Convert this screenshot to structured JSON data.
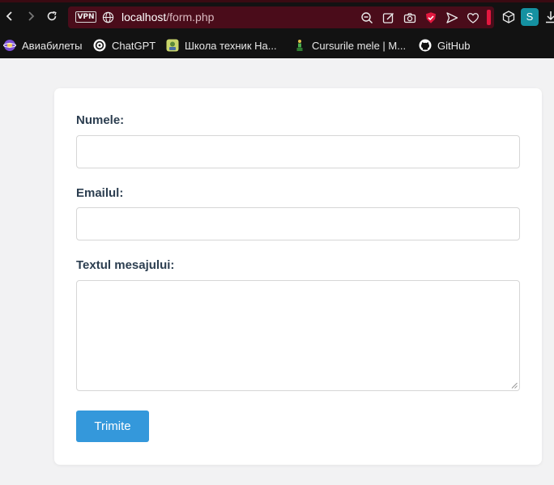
{
  "browser": {
    "vpn_label": "VPN",
    "url_host": "localhost",
    "url_path": "/form.php",
    "profile_initial": "S"
  },
  "bookmarks": [
    {
      "label": "Авиабилеты"
    },
    {
      "label": "ChatGPT"
    },
    {
      "label": "Школа техник На..."
    },
    {
      "label": "Cursurile mele | M..."
    },
    {
      "label": "GitHub"
    }
  ],
  "form": {
    "name_label": "Numele:",
    "email_label": "Emailul:",
    "message_label": "Textul mesajului:",
    "name_value": "",
    "email_value": "",
    "message_value": "",
    "submit_label": "Trimite"
  },
  "colors": {
    "accent": "#3498db",
    "label_text": "#2c3e50",
    "url_bar": "#4a0c1a"
  }
}
